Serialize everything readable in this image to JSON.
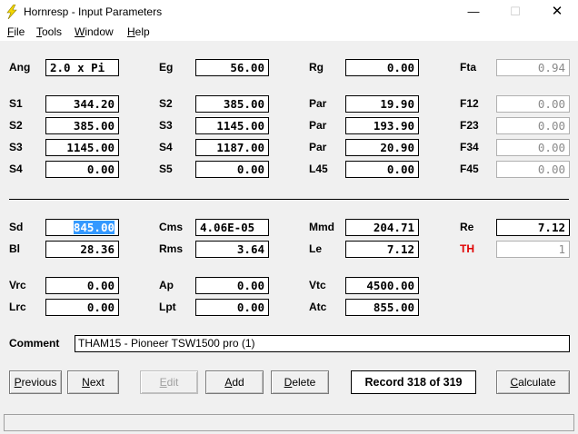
{
  "window": {
    "title": "Hornresp - Input Parameters",
    "minimize_glyph": "—",
    "maximize_glyph": "☐",
    "close_glyph": "✕"
  },
  "menu": {
    "file_u": "F",
    "file_rest": "ile",
    "tools_u": "T",
    "tools_rest": "ools",
    "window_u": "W",
    "window_rest": "indow",
    "help_u": "H",
    "help_rest": "elp"
  },
  "horn": {
    "ang_label": "Ang",
    "ang": "2.0 x Pi",
    "eg_label": "Eg",
    "eg": "56.00",
    "rg_label": "Rg",
    "rg": "0.00",
    "fta_label": "Fta",
    "fta": "0.94",
    "s1_label": "S1",
    "s1": "344.20",
    "s2_label": "S2",
    "s2": "385.00",
    "s3_label": "S3",
    "s3": "1145.00",
    "s4_label": "S4",
    "s4": "0.00",
    "s2b_label": "S2",
    "s2b": "385.00",
    "s3b_label": "S3",
    "s3b": "1145.00",
    "s4b_label": "S4",
    "s4b": "1187.00",
    "s5_label": "S5",
    "s5": "0.00",
    "par1_label": "Par",
    "par1": "19.90",
    "par2_label": "Par",
    "par2": "193.90",
    "par3_label": "Par",
    "par3": "20.90",
    "l45_label": "L45",
    "l45": "0.00",
    "f12_label": "F12",
    "f12": "0.00",
    "f23_label": "F23",
    "f23": "0.00",
    "f34_label": "F34",
    "f34": "0.00",
    "f45_label": "F45",
    "f45": "0.00"
  },
  "driver": {
    "sd_label": "Sd",
    "sd": "845.00",
    "bl_label": "Bl",
    "bl": "28.36",
    "cms_label": "Cms",
    "cms": "4.06E-05",
    "rms_label": "Rms",
    "rms": "3.64",
    "mmd_label": "Mmd",
    "mmd": "204.71",
    "le_label": "Le",
    "le": "7.12",
    "re_label": "Re",
    "re": "7.12",
    "th_label": "TH",
    "th": "1",
    "vrc_label": "Vrc",
    "vrc": "0.00",
    "lrc_label": "Lrc",
    "lrc": "0.00",
    "ap_label": "Ap",
    "ap": "0.00",
    "lpt_label": "Lpt",
    "lpt": "0.00",
    "vtc_label": "Vtc",
    "vtc": "4500.00",
    "atc_label": "Atc",
    "atc": "855.00"
  },
  "comment": {
    "label": "Comment",
    "value": "THAM15 - Pioneer TSW1500 pro (1)"
  },
  "buttons": {
    "previous_u": "P",
    "previous_rest": "revious",
    "next_u": "N",
    "next_rest": "ext",
    "edit_u": "E",
    "edit_rest": "dit",
    "add_u": "A",
    "add_rest": "dd",
    "delete_u": "D",
    "delete_rest": "elete",
    "calculate_u": "C",
    "calculate_rest": "alculate"
  },
  "record": "Record 318 of 319",
  "colors": {
    "titlebar": "#ffffff",
    "background": "#f0f0f0",
    "selection": "#3399ff",
    "th_label": "#e00000"
  }
}
